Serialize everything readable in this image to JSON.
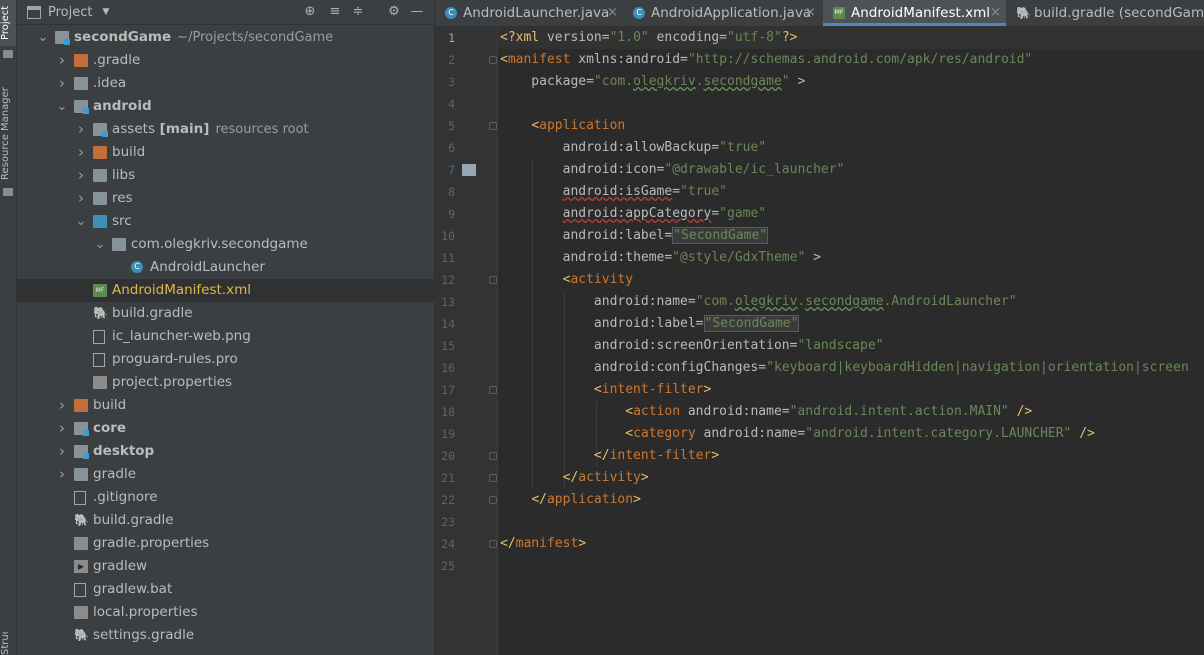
{
  "left_strip": {
    "project_label": "Project",
    "resource_manager_label": "Resource Manager",
    "structure_label": "Structure"
  },
  "project_panel": {
    "title": "Project",
    "tree": [
      {
        "label": "secondGame",
        "suffix": "~/Projects/secondGame",
        "depth": 0,
        "arrow": "down",
        "icon": "module-folder",
        "bold": true
      },
      {
        "label": ".gradle",
        "depth": 1,
        "arrow": "right",
        "icon": "folder-orange"
      },
      {
        "label": ".idea",
        "depth": 1,
        "arrow": "right",
        "icon": "folder-grey"
      },
      {
        "label": "android",
        "depth": 1,
        "arrow": "down",
        "icon": "module-folder",
        "bold": true
      },
      {
        "label": "assets",
        "tag": "[main]",
        "suffix": "resources root",
        "depth": 2,
        "arrow": "right",
        "icon": "resources-folder"
      },
      {
        "label": "build",
        "depth": 2,
        "arrow": "right",
        "icon": "folder-orange"
      },
      {
        "label": "libs",
        "depth": 2,
        "arrow": "right",
        "icon": "folder-grey"
      },
      {
        "label": "res",
        "depth": 2,
        "arrow": "right",
        "icon": "folder-grey"
      },
      {
        "label": "src",
        "depth": 2,
        "arrow": "down",
        "icon": "folder-blue"
      },
      {
        "label": "com.olegkriv.secondgame",
        "depth": 3,
        "arrow": "down",
        "icon": "package-folder"
      },
      {
        "label": "AndroidLauncher",
        "depth": 4,
        "arrow": "",
        "icon": "java-class"
      },
      {
        "label": "AndroidManifest.xml",
        "depth": 2,
        "arrow": "",
        "icon": "manifest-file",
        "selected": true,
        "highlight": true
      },
      {
        "label": "build.gradle",
        "depth": 2,
        "arrow": "",
        "icon": "gradle-file"
      },
      {
        "label": "ic_launcher-web.png",
        "depth": 2,
        "arrow": "",
        "icon": "image-file"
      },
      {
        "label": "proguard-rules.pro",
        "depth": 2,
        "arrow": "",
        "icon": "text-file"
      },
      {
        "label": "project.properties",
        "depth": 2,
        "arrow": "",
        "icon": "properties-file"
      },
      {
        "label": "build",
        "depth": 1,
        "arrow": "right",
        "icon": "folder-orange"
      },
      {
        "label": "core",
        "depth": 1,
        "arrow": "right",
        "icon": "module-folder",
        "bold": true
      },
      {
        "label": "desktop",
        "depth": 1,
        "arrow": "right",
        "icon": "module-folder",
        "bold": true
      },
      {
        "label": "gradle",
        "depth": 1,
        "arrow": "right",
        "icon": "folder-grey"
      },
      {
        "label": ".gitignore",
        "depth": 1,
        "arrow": "",
        "icon": "text-file"
      },
      {
        "label": "build.gradle",
        "depth": 1,
        "arrow": "",
        "icon": "gradle-file"
      },
      {
        "label": "gradle.properties",
        "depth": 1,
        "arrow": "",
        "icon": "properties-file"
      },
      {
        "label": "gradlew",
        "depth": 1,
        "arrow": "",
        "icon": "terminal-file"
      },
      {
        "label": "gradlew.bat",
        "depth": 1,
        "arrow": "",
        "icon": "text-file"
      },
      {
        "label": "local.properties",
        "depth": 1,
        "arrow": "",
        "icon": "properties-file"
      },
      {
        "label": "settings.gradle",
        "depth": 1,
        "arrow": "",
        "icon": "gradle-file"
      }
    ]
  },
  "tabs": [
    {
      "label": "AndroidLauncher.java",
      "icon": "java-class",
      "active": false
    },
    {
      "label": "AndroidApplication.java",
      "icon": "java-class",
      "active": false
    },
    {
      "label": "AndroidManifest.xml",
      "icon": "manifest-file",
      "active": true
    },
    {
      "label": "build.gradle (secondGame)",
      "icon": "gradle-file",
      "active": false
    }
  ],
  "editor": {
    "current_line": 1,
    "lines": [
      "1",
      "2",
      "3",
      "4",
      "5",
      "6",
      "7",
      "8",
      "9",
      "10",
      "11",
      "12",
      "13",
      "14",
      "15",
      "16",
      "17",
      "18",
      "19",
      "20",
      "21",
      "22",
      "23",
      "24",
      "25"
    ]
  }
}
